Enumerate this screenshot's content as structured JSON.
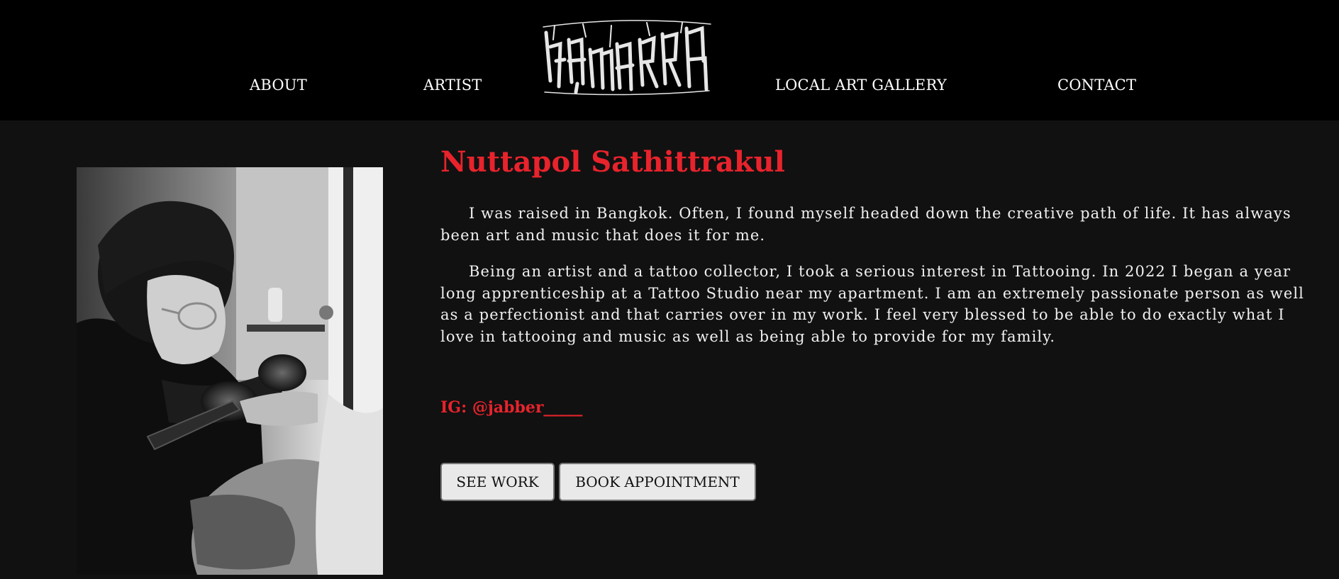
{
  "nav": {
    "items": [
      {
        "label": "ABOUT"
      },
      {
        "label": "ARTIST"
      },
      {
        "label": "LOCAL ART GALLERY"
      },
      {
        "label": "CONTACT"
      }
    ],
    "logo_icon": "blackletter-logo-icon"
  },
  "artist": {
    "name": "Nuttapol Sathittrakul",
    "bio": [
      "I was raised in Bangkok. Often, I found myself headed down the creative path of life. It has always been art and music that does it for me.",
      "Being an artist and a tattoo collector, I took a serious interest in Tattooing. In 2022 I began a year long apprenticeship at a Tattoo Studio near my apartment. I am an extremely passionate person as well as a perfectionist and that carries over in my work. I feel very blessed to be able to do exactly what I love in tattooing and music as well as being able to provide for my family."
    ],
    "instagram": "IG: @jabber_____",
    "photo_icon": "artist-portrait-photo"
  },
  "buttons": {
    "see_work": "SEE WORK",
    "book": "BOOK APPOINTMENT"
  },
  "colors": {
    "accent": "#e8232c",
    "header_bg": "#000000",
    "page_bg": "#111111",
    "button_bg": "#e9e9e9"
  }
}
